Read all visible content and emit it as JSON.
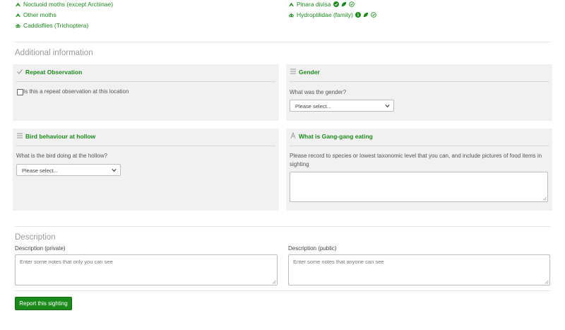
{
  "species_left": [
    {
      "label": "Noctuoid moths (except Arctiinae)",
      "icon": "moth-icon"
    },
    {
      "label": "Other moths",
      "icon": "moth-icon"
    },
    {
      "label": "Caddisflies (Trichoptera)",
      "icon": "caddisfly-icon"
    }
  ],
  "species_right": [
    {
      "label": "Pinara divisa",
      "icon": "moth-icon",
      "badges": [
        "verified-check-icon",
        "leaf-icon",
        "circle-check-icon"
      ]
    },
    {
      "label": "Hydroptilidae (family)",
      "icon": "caddisfly-icon",
      "badges": [
        "info-icon",
        "leaf-icon",
        "circle-check-icon"
      ]
    }
  ],
  "additional": {
    "title": "Additional information",
    "repeat": {
      "title": "Repeat Observation",
      "checkbox_label": "Is this a repeat observation at this location",
      "checked": false
    },
    "gender": {
      "title": "Gender",
      "question": "What was the gender?",
      "select_value": "Please select..."
    },
    "behaviour": {
      "title": "Bird behaviour at hollow",
      "question": "What is the bird doing at the hollow?",
      "select_value": "Please select..."
    },
    "eating": {
      "title": "What is Gang-gang eating",
      "question": "Please record to species or lowest taxonomic level that you can, and include pictures of food items in sighting",
      "value": ""
    }
  },
  "description": {
    "title": "Description",
    "private_label": "Description (private)",
    "private_placeholder": "Enter some notes that only you can see",
    "public_label": "Description (public)",
    "public_placeholder": "Enter some notes that anyone can see"
  },
  "submit_label": "Report this sighting",
  "colors": {
    "accent": "#1d8a1d",
    "button": "#1a8a1a",
    "panel": "#f1f1f1"
  }
}
